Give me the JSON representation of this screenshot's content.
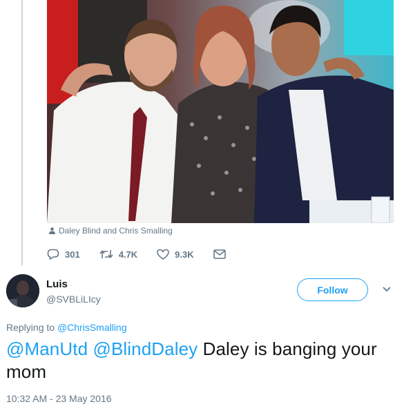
{
  "photo": {
    "caption": "Daley Blind and Chris Smalling",
    "caption_icon": "person-icon"
  },
  "actions": {
    "replies": "301",
    "retweets": "4.7K",
    "likes": "9.3K",
    "icons": [
      "reply-icon",
      "retweet-icon",
      "like-icon",
      "message-icon"
    ]
  },
  "reply": {
    "display_name": "Luis",
    "handle": "@SVBLiLIcy",
    "follow_label": "Follow",
    "replying_prefix": "Replying to",
    "replying_to": "@ChrisSmalling",
    "mention_1": "@ManUtd",
    "mention_2": "@BlindDaley",
    "text": "Daley is banging your mom",
    "timestamp": "10:32 AM - 23 May 2016"
  },
  "colors": {
    "accent": "#1da1f2",
    "secondary_text": "#657786",
    "primary_text": "#14171a"
  }
}
